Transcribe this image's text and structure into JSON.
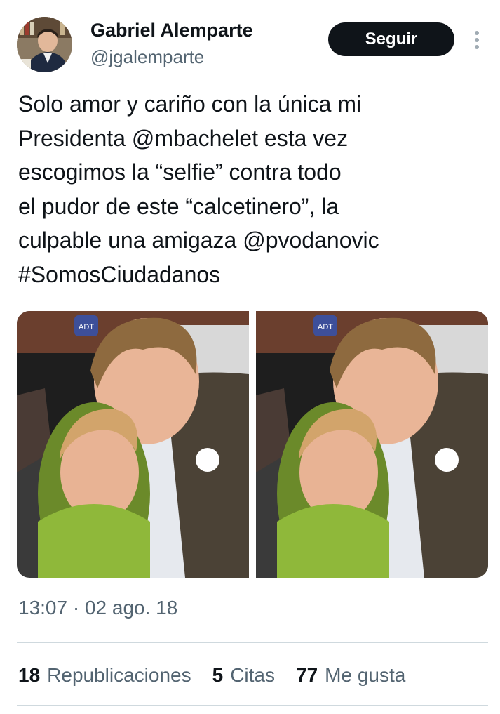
{
  "author": {
    "name": "Gabriel Alemparte",
    "handle": "@jgalemparte"
  },
  "follow_label": "Seguir",
  "tweet": {
    "text": "Solo amor y cariño con la única mi\nPresidenta @mbachelet esta vez\nescogimos la “selfie” contra todo\nel pudor de este “calcetinero”, la\nculpable una amigaza @pvodanovic\n#SomosCiudadanos"
  },
  "photo_badge": "ADT",
  "timestamp": "13:07 · 02 ago. 18",
  "stats": [
    {
      "count": "18",
      "label": "Republicaciones"
    },
    {
      "count": "5",
      "label": "Citas"
    },
    {
      "count": "77",
      "label": "Me gusta"
    }
  ],
  "colors": {
    "text_primary": "#0f1419",
    "text_secondary": "#536471",
    "button_bg": "#0f1419",
    "divider": "#cfd9de"
  }
}
